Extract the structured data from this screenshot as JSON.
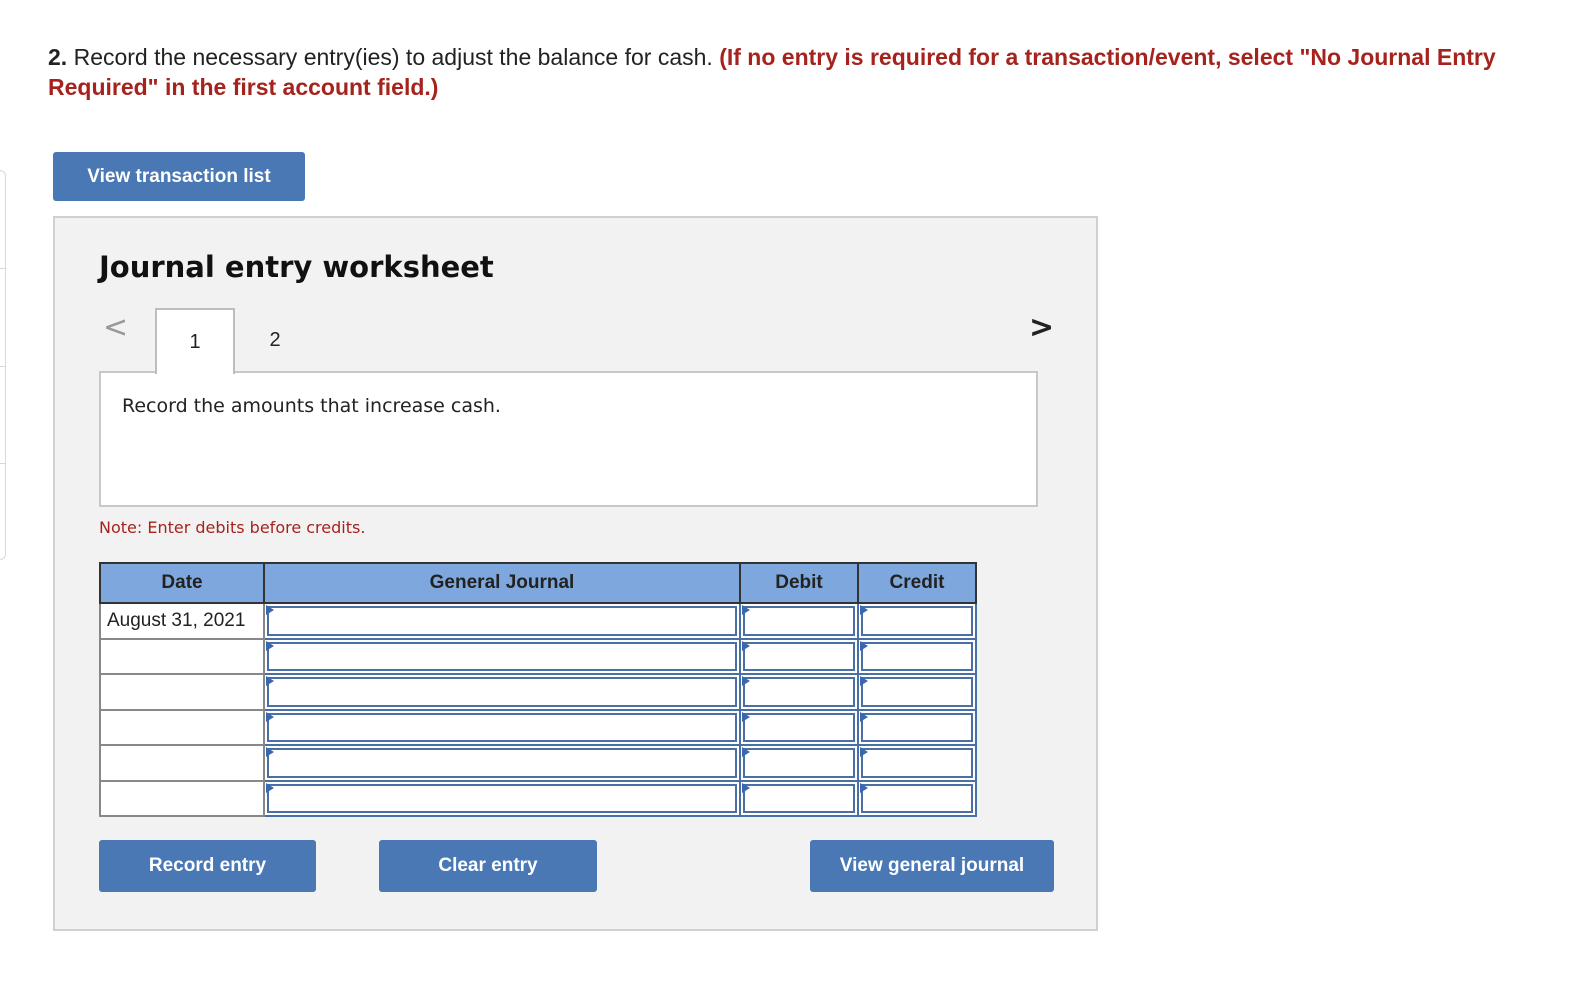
{
  "question": {
    "number": "2.",
    "text": " Record the necessary entry(ies) to adjust the balance for cash. ",
    "instruction": "(If no entry is required for a transaction/event, select \"No Journal Entry Required\" in the first account field.)"
  },
  "buttons": {
    "view_transaction_list": "View transaction list",
    "record_entry": "Record entry",
    "clear_entry": "Clear entry",
    "view_general_journal": "View general journal"
  },
  "worksheet": {
    "title": "Journal entry worksheet",
    "nav_prev": "<",
    "nav_next": ">",
    "tabs": [
      "1",
      "2"
    ],
    "active_tab": "1",
    "prompt": "Record the amounts that increase cash.",
    "note": "Note: Enter debits before credits."
  },
  "journal": {
    "headers": [
      "Date",
      "General Journal",
      "Debit",
      "Credit"
    ],
    "rows": [
      {
        "date": "August 31, 2021",
        "account": "",
        "debit": "",
        "credit": ""
      },
      {
        "date": "",
        "account": "",
        "debit": "",
        "credit": ""
      },
      {
        "date": "",
        "account": "",
        "debit": "",
        "credit": ""
      },
      {
        "date": "",
        "account": "",
        "debit": "",
        "credit": ""
      },
      {
        "date": "",
        "account": "",
        "debit": "",
        "credit": ""
      },
      {
        "date": "",
        "account": "",
        "debit": "",
        "credit": ""
      }
    ]
  },
  "colors": {
    "button": "#4a78b5",
    "header": "#7ea8dd",
    "instruction": "#a6231d"
  }
}
